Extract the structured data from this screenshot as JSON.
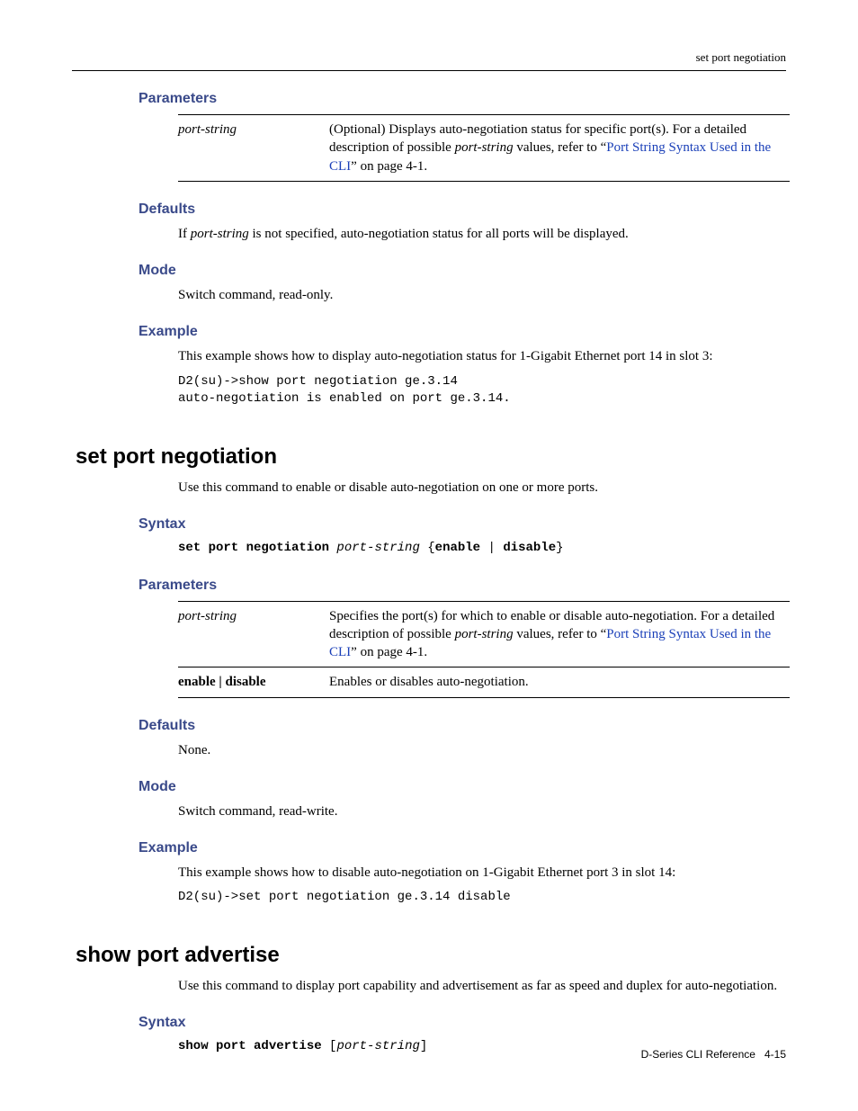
{
  "running_head": "set port negotiation",
  "section1": {
    "h_parameters": "Parameters",
    "table": {
      "r1c1": "port-string",
      "r1c2a": "(Optional) Displays auto-negotiation status for specific port(s). For a detailed description of possible ",
      "r1c2b": "port-string",
      "r1c2c": " values, refer to “",
      "r1c2link": "Port String Syntax Used in the CLI",
      "r1c2d": "” on page 4-1."
    },
    "h_defaults": "Defaults",
    "defaults_text_a": "If ",
    "defaults_text_b": "port-string",
    "defaults_text_c": " is not specified, auto-negotiation status for all ports will be displayed.",
    "h_mode": "Mode",
    "mode_text": "Switch command, read-only.",
    "h_example": "Example",
    "example_text": "This example shows how to display auto-negotiation status for 1-Gigabit Ethernet port 14 in slot 3:",
    "example_code": "D2(su)->show port negotiation ge.3.14\nauto-negotiation is enabled on port ge.3.14."
  },
  "section2": {
    "h_main": "set port negotiation",
    "intro": "Use this command to enable or disable auto-negotiation on one or more ports.",
    "h_syntax": "Syntax",
    "syntax_a": "set port negotiation",
    "syntax_b": " port-string",
    "syntax_c": " {",
    "syntax_d": "enable",
    "syntax_e": " | ",
    "syntax_f": "disable",
    "syntax_g": "}",
    "h_parameters": "Parameters",
    "table": {
      "r1c1": "port-string",
      "r1c2a": "Specifies the port(s) for which to enable or disable auto-negotiation. For a detailed description of possible ",
      "r1c2b": "port-string",
      "r1c2c": " values, refer to “",
      "r1c2link": "Port String Syntax Used in the CLI",
      "r1c2d": "” on page 4-1.",
      "r2c1": "enable | disable",
      "r2c2": "Enables or disables auto-negotiation."
    },
    "h_defaults": "Defaults",
    "defaults_text": "None.",
    "h_mode": "Mode",
    "mode_text": "Switch command, read-write.",
    "h_example": "Example",
    "example_text": "This example shows how to disable auto-negotiation on 1-Gigabit Ethernet port 3 in slot 14:",
    "example_code": "D2(su)->set port negotiation ge.3.14 disable"
  },
  "section3": {
    "h_main": "show port advertise",
    "intro": "Use this command to display port capability and advertisement as far as speed and duplex for auto-negotiation.",
    "h_syntax": "Syntax",
    "syntax_a": "show port advertise",
    "syntax_b": " [",
    "syntax_c": "port-string",
    "syntax_d": "]"
  },
  "footer": {
    "label": "D-Series CLI Reference",
    "page": "4-15"
  }
}
